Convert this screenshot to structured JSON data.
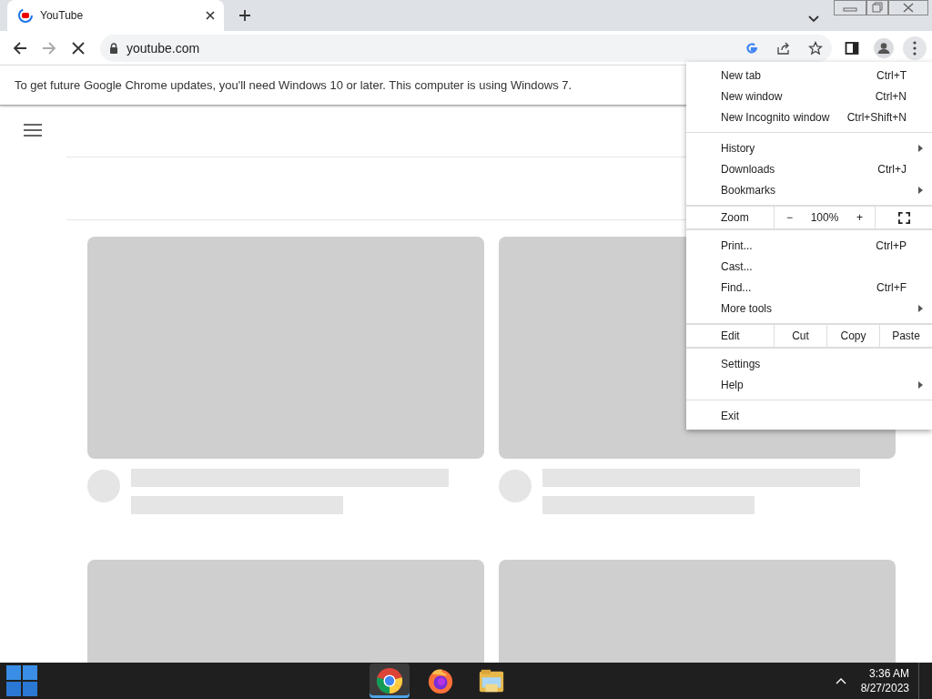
{
  "tab": {
    "title": "YouTube",
    "selected": true
  },
  "address": {
    "url": "youtube.com"
  },
  "infobar": {
    "text": "To get future Google Chrome updates, you'll need Windows 10 or later. This computer is using Windows 7."
  },
  "menu": {
    "sections": [
      [
        {
          "kind": "item",
          "label": "New tab",
          "shortcut": "Ctrl+T",
          "submenu": false
        },
        {
          "kind": "item",
          "label": "New window",
          "shortcut": "Ctrl+N",
          "submenu": false
        },
        {
          "kind": "item",
          "label": "New Incognito window",
          "shortcut": "Ctrl+Shift+N",
          "submenu": false
        }
      ],
      [
        {
          "kind": "item",
          "label": "History",
          "submenu": true
        },
        {
          "kind": "item",
          "label": "Downloads",
          "shortcut": "Ctrl+J",
          "submenu": false
        },
        {
          "kind": "item",
          "label": "Bookmarks",
          "submenu": true
        }
      ],
      [
        {
          "kind": "zoom",
          "label": "Zoom",
          "minus": "−",
          "value": "100%",
          "plus": "+"
        }
      ],
      [
        {
          "kind": "item",
          "label": "Print...",
          "shortcut": "Ctrl+P",
          "submenu": false
        },
        {
          "kind": "item",
          "label": "Cast...",
          "submenu": false
        },
        {
          "kind": "item",
          "label": "Find...",
          "shortcut": "Ctrl+F",
          "submenu": false
        },
        {
          "kind": "item",
          "label": "More tools",
          "submenu": true
        }
      ],
      [
        {
          "kind": "edit",
          "label": "Edit",
          "buttons": [
            "Cut",
            "Copy",
            "Paste"
          ]
        }
      ],
      [
        {
          "kind": "item",
          "label": "Settings",
          "submenu": false
        },
        {
          "kind": "item",
          "label": "Help",
          "submenu": true
        }
      ],
      [
        {
          "kind": "item",
          "label": "Exit",
          "submenu": false
        }
      ]
    ]
  },
  "taskbar": {
    "apps": [
      {
        "kind": "chrome",
        "selected": true
      },
      {
        "kind": "firefox",
        "selected": false
      },
      {
        "kind": "explorer",
        "selected": false
      }
    ],
    "time": "3:36 AM",
    "date": "8/27/2023"
  }
}
